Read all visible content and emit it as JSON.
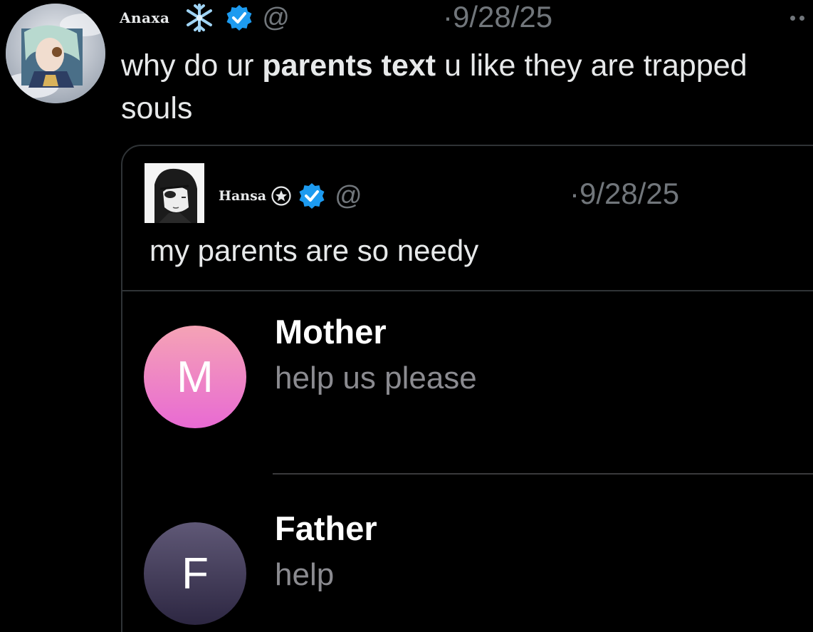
{
  "tweet": {
    "display_name": "Anaxa",
    "emoji": "snowflake",
    "verified": true,
    "handle": "@",
    "timestamp": "·9/28/25",
    "text_before": "why do ur ",
    "text_bold": "parents text",
    "text_after": " u like they are trapped souls",
    "avatar": "anime-character-avatar"
  },
  "quote": {
    "display_name": "Hansa",
    "badge": "star-circle-icon",
    "verified": true,
    "handle": "@",
    "timestamp": "·9/28/25",
    "text": "my parents are so needy",
    "avatar": "manga-character-avatar"
  },
  "messages": [
    {
      "initial": "M",
      "name": "Mother",
      "preview": "help us please",
      "color_top": "#f5a3b5",
      "color_bottom": "#e86ad3"
    },
    {
      "initial": "F",
      "name": "Father",
      "preview": "help",
      "color_top": "#5f5876",
      "color_bottom": "#2d2742"
    }
  ],
  "colors": {
    "background": "#000000",
    "text": "#e7e9ea",
    "muted": "#71767b",
    "verified_blue": "#1d9bf0",
    "border": "#2f3336"
  }
}
